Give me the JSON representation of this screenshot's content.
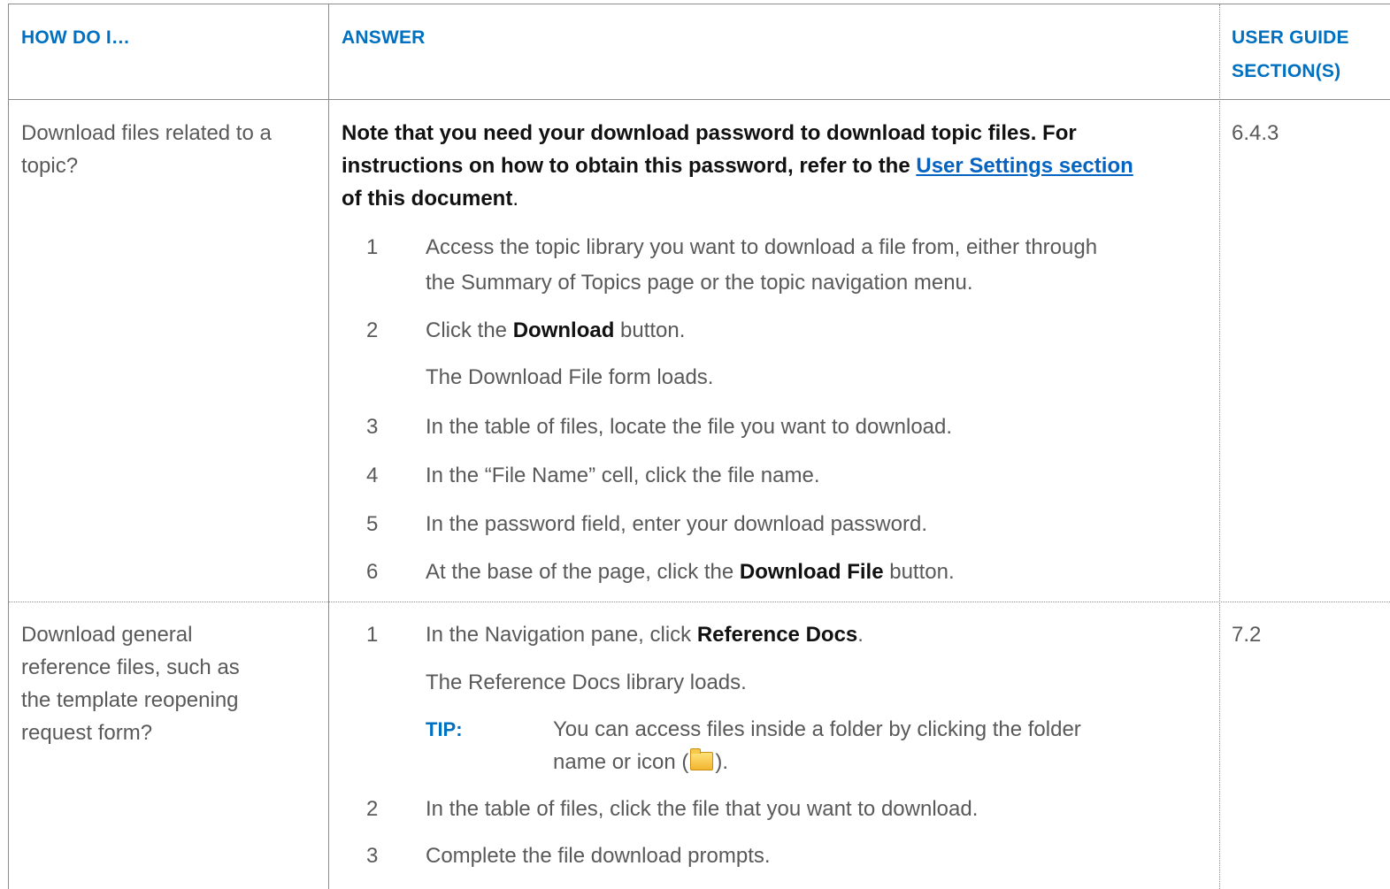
{
  "header": {
    "col1": "HOW DO I…",
    "col2": "ANSWER",
    "col3_line1": "USER GUIDE",
    "col3_line2": "SECTION(S)"
  },
  "rows": [
    {
      "question_lines": [
        "Download files related to a",
        "topic?"
      ],
      "section": "6.4.3",
      "note": {
        "line1": "Note that you need your download password to download topic files. For",
        "line2_before": "instructions on how to obtain this password, refer to the ",
        "link": "User Settings section",
        "line3": "of this document",
        "line3_end": "."
      },
      "steps": [
        {
          "num": "1",
          "line1": "Access the topic library you want to download a file from, either through",
          "line2": "the Summary of Topics page or the topic navigation menu."
        },
        {
          "num": "2",
          "before": "Click the ",
          "bold": "Download",
          "after": " button.",
          "sub": "The Download File form loads."
        },
        {
          "num": "3",
          "text": "In the table of files, locate the file you want to download."
        },
        {
          "num": "4",
          "text": "In the “File Name” cell, click the file name."
        },
        {
          "num": "5",
          "text": "In the password field, enter your download password."
        },
        {
          "num": "6",
          "before": "At the base of the page, click the ",
          "bold": "Download File",
          "after": " button."
        }
      ]
    },
    {
      "question_lines": [
        "Download general",
        "reference files, such as",
        "the template reopening",
        "request form?"
      ],
      "section": "7.2",
      "steps": [
        {
          "num": "1",
          "before": "In the Navigation pane, click ",
          "bold": "Reference Docs",
          "after": ".",
          "sub": "The Reference Docs library loads."
        },
        {
          "num": "2",
          "text": "In the table of files, click the file that you want to download."
        },
        {
          "num": "3",
          "text": "Complete the file download prompts."
        }
      ],
      "tip": {
        "label": "TIP:",
        "line1": "You can access files inside a folder by clicking the folder",
        "line2_before": "name or icon (",
        "icon": "folder-icon",
        "line2_after": ")."
      }
    }
  ]
}
